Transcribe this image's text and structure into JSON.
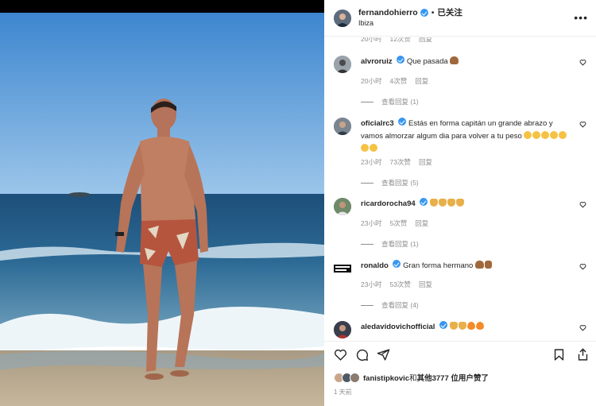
{
  "post": {
    "username": "fernandohierro",
    "separator": "•",
    "follow_label": "已关注",
    "location": "Ibiza",
    "more_icon": "more-horizontal-icon"
  },
  "comments": {
    "top_meta": {
      "time": "20小时",
      "likes": "12次赞",
      "reply": "回复"
    },
    "items": [
      {
        "user": "alvroruiz",
        "text": "Que pasada",
        "emojis": [
          "arm"
        ],
        "time": "20小时",
        "likes": "4次赞",
        "reply": "回复",
        "replies": "查看回复 (1)"
      },
      {
        "user": "oficialrc3",
        "text": "Estás en forma capitán un grande abrazo y vamos almorzar algum dia para volver a tu peso",
        "emojis": [
          "face",
          "face",
          "face",
          "face",
          "face",
          "face",
          "face"
        ],
        "time": "23小时",
        "likes": "73次赞",
        "reply": "回复",
        "replies": "查看回复 (5)"
      },
      {
        "user": "ricardorocha94",
        "text": "",
        "emojis": [
          "hand",
          "hand",
          "hand",
          "hand"
        ],
        "time": "23小时",
        "likes": "5次赞",
        "reply": "回复",
        "replies": "查看回复 (1)"
      },
      {
        "user": "ronaldo",
        "text": "Gran forma hermano",
        "emojis": [
          "arm",
          "thumb"
        ],
        "time": "23小时",
        "likes": "53次赞",
        "reply": "回复",
        "replies": "查看回复 (4)"
      },
      {
        "user": "aledavidovichofficial",
        "text": "",
        "emojis": [
          "hand",
          "hand",
          "fire",
          "fire"
        ]
      }
    ]
  },
  "actions": {
    "like_icon": "heart-icon",
    "comment_icon": "comment-icon",
    "share_icon": "share-icon",
    "save_icon": "bookmark-icon"
  },
  "likes": {
    "user": "fanistipkovic",
    "conjunction": "和",
    "others": "其他3777 位用户赞了"
  },
  "time_ago": "1 天前",
  "colors": {
    "verified": "#3897f0",
    "sky": "#5b9bd5",
    "sea": "#1f5f8b",
    "sand": "#b8a98f"
  }
}
